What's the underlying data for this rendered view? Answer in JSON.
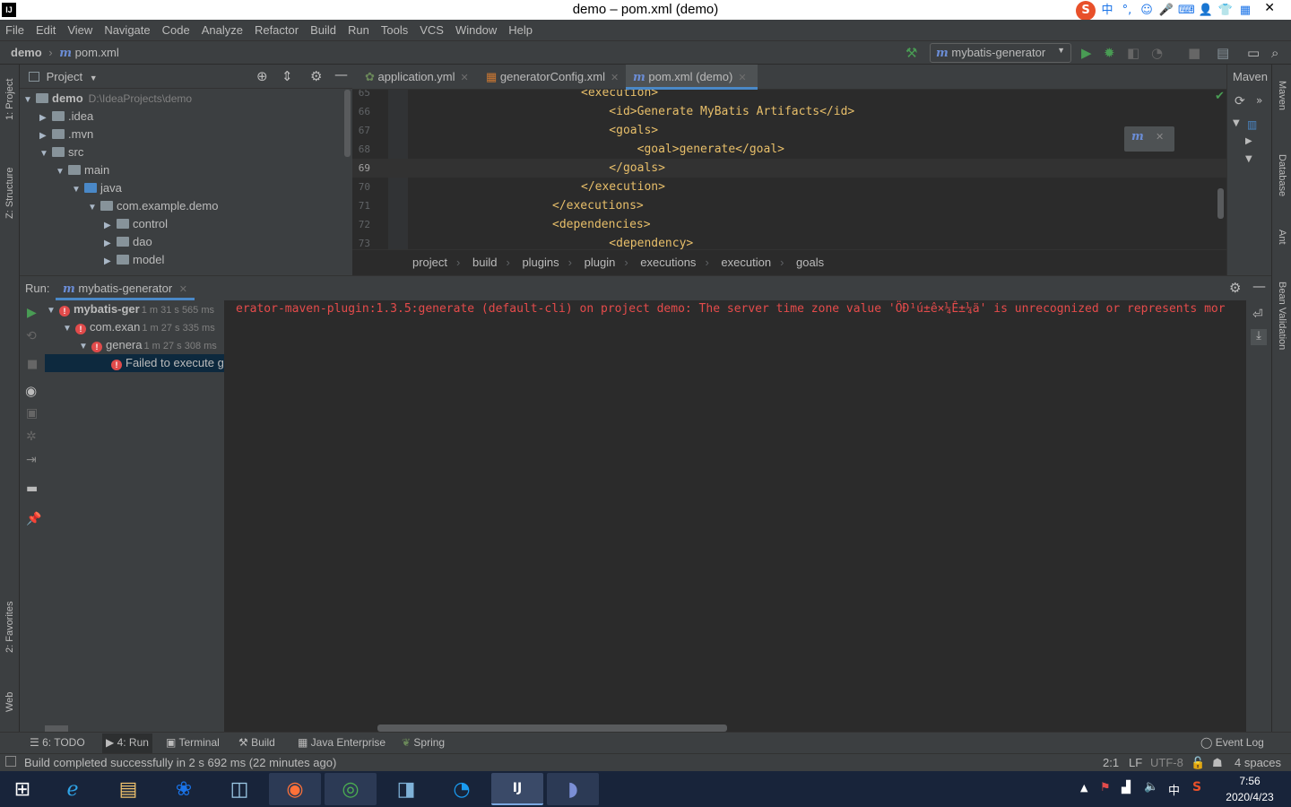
{
  "window": {
    "title": "demo – pom.xml (demo)",
    "app_logo": "IJ",
    "close": "✕"
  },
  "ime": {
    "icons": [
      "S",
      "中",
      "°,",
      "☺",
      "🎤",
      "⌨",
      "👤",
      "👕",
      "▦"
    ]
  },
  "menu": [
    "File",
    "Edit",
    "View",
    "Navigate",
    "Code",
    "Analyze",
    "Refactor",
    "Build",
    "Run",
    "Tools",
    "VCS",
    "Window",
    "Help"
  ],
  "navbar": {
    "project": "demo",
    "file": "pom.xml",
    "run_config": "mybatis-generator",
    "m_glyph": "m"
  },
  "left_tools": {
    "project": "1: Project",
    "structure": "Z: Structure",
    "favorites": "2: Favorites",
    "web": "Web"
  },
  "right_tools": {
    "maven": "Maven",
    "database": "Database",
    "ant": "Ant",
    "bean": "Bean Validation"
  },
  "project_panel": {
    "header": "Project",
    "tree": [
      {
        "label": "demo",
        "hint": "D:\\IdeaProjects\\demo",
        "expanded": "▼"
      },
      {
        "label": ".idea",
        "expanded": "▶"
      },
      {
        "label": ".mvn",
        "expanded": "▶"
      },
      {
        "label": "src",
        "expanded": "▼"
      },
      {
        "label": "main",
        "expanded": "▼"
      },
      {
        "label": "java",
        "expanded": "▼"
      },
      {
        "label": "com.example.demo",
        "expanded": "▼"
      },
      {
        "label": "control",
        "expanded": "▶"
      },
      {
        "label": "dao",
        "expanded": "▶"
      },
      {
        "label": "model",
        "expanded": "▶"
      }
    ]
  },
  "editor": {
    "tabs": [
      {
        "label": "application.yml"
      },
      {
        "label": "generatorConfig.xml"
      },
      {
        "label": "pom.xml (demo)"
      }
    ],
    "lines": [
      {
        "n": "65",
        "code": "<execution>"
      },
      {
        "n": "66",
        "code": "    <id>Generate MyBatis Artifacts</id>"
      },
      {
        "n": "67",
        "code": "    <goals>"
      },
      {
        "n": "68",
        "code": "        <goal>generate</goal>"
      },
      {
        "n": "69",
        "code": "    </goals>"
      },
      {
        "n": "70",
        "code": "</execution>"
      },
      {
        "n": "71",
        "code": "</executions>"
      },
      {
        "n": "72",
        "code": "<dependencies>"
      },
      {
        "n": "73",
        "code": "    <dependency>"
      }
    ],
    "breadcrumb": [
      "project",
      "build",
      "plugins",
      "plugin",
      "executions",
      "execution",
      "goals"
    ]
  },
  "maven_panel": {
    "title": "Maven"
  },
  "run_panel": {
    "label": "Run:",
    "tab": "mybatis-generator",
    "tree": [
      {
        "label": "mybatis-ger",
        "time": "1 m 31 s 565 ms"
      },
      {
        "label": "com.exan",
        "time": "1 m 27 s 335 ms"
      },
      {
        "label": "genera",
        "time": "1 m 27 s 308 ms"
      },
      {
        "label": "Failed to execute g",
        "time": ""
      }
    ],
    "console": "erator-maven-plugin:1.3.5:generate (default-cli) on project demo: The server time zone value 'ÖÐ¹ú±ê×¼Ê±¼ä' is unrecognized or represents mor"
  },
  "bottom_tools": [
    {
      "label": "6: TODO"
    },
    {
      "label": "4: Run"
    },
    {
      "label": "Terminal"
    },
    {
      "label": "Build"
    },
    {
      "label": "Java Enterprise"
    },
    {
      "label": "Spring"
    }
  ],
  "event_log": "Event Log",
  "status": {
    "message": "Build completed successfully in 2 s 692 ms (22 minutes ago)",
    "position": "2:1",
    "line_sep": "LF",
    "encoding": "UTF-8",
    "indent": "4 spaces"
  },
  "taskbar": {
    "time": "7:56",
    "date": "2020/4/23",
    "ime": "中"
  },
  "colors": {
    "accent": "#4a88c7",
    "error": "#e54b4b",
    "xml_tag": "#e8bf6a",
    "run_green": "#499c54"
  }
}
